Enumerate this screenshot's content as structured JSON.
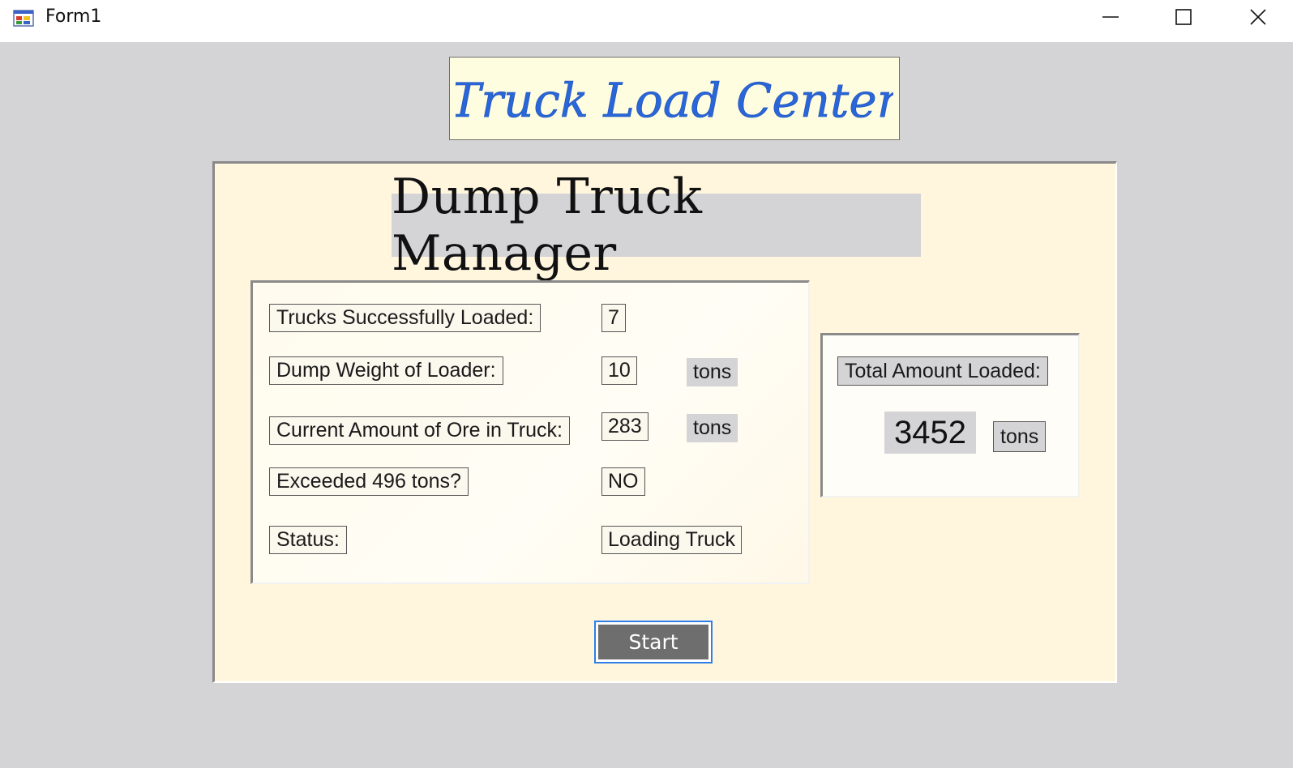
{
  "window": {
    "title": "Form1",
    "controls": {
      "minimize": "minimize-icon",
      "maximize": "maximize-icon",
      "close": "close-icon"
    }
  },
  "banner": {
    "text": "Truck Load Center",
    "text_color": "#2a66d8",
    "background": "#fffde0"
  },
  "heading": {
    "text": "Dump Truck Manager"
  },
  "fields": {
    "trucks_loaded": {
      "label": "Trucks Successfully Loaded:",
      "value": "7"
    },
    "dump_weight": {
      "label": "Dump Weight of Loader:",
      "value": "10",
      "unit": "tons"
    },
    "current_ore": {
      "label": "Current Amount of Ore in Truck:",
      "value": "283",
      "unit": "tons"
    },
    "exceeded": {
      "label": "Exceeded 496 tons?",
      "value": "NO"
    },
    "status": {
      "label": "Status:",
      "value": "Loading Truck"
    }
  },
  "total": {
    "label": "Total Amount Loaded:",
    "value": "3452",
    "unit": "tons"
  },
  "start_button": {
    "label": "Start"
  },
  "colors": {
    "form_background": "#d4d3d6",
    "panel_background": "#fff6dd",
    "button_background": "#6e6e6e",
    "button_focus_border": "#2f7ee8"
  }
}
